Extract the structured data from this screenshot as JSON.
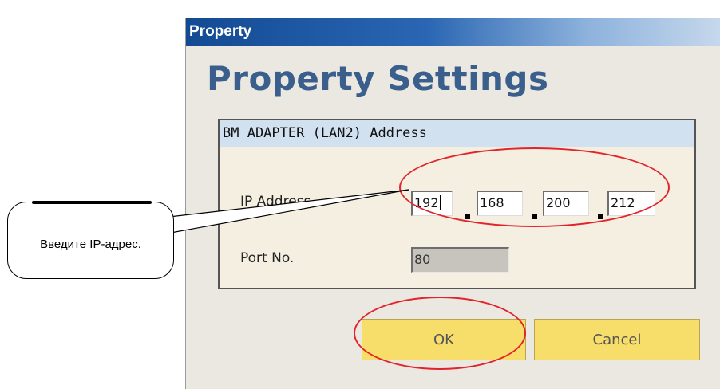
{
  "window": {
    "title": "Property",
    "heading": "Property Settings"
  },
  "group": {
    "title": "BM ADAPTER (LAN2) Address",
    "ip_label": "IP Address",
    "ip_octets": [
      "192",
      "168",
      "200",
      "212"
    ],
    "port_label": "Port No.",
    "port_value": "80"
  },
  "buttons": {
    "ok": "OK",
    "cancel": "Cancel"
  },
  "callout": {
    "text": "Введите IP-адрес."
  },
  "colors": {
    "title_bar": "#2a66b3",
    "heading": "#3b5f8c",
    "button": "#f7dd6a",
    "highlight_ellipse": "#e3232a"
  }
}
